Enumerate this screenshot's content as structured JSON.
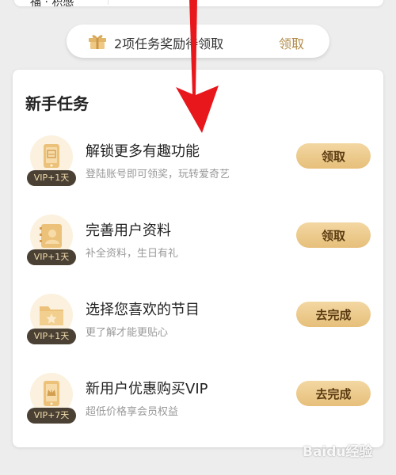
{
  "top_card": {
    "partial_text": "福 · 积感"
  },
  "reward_banner": {
    "text": "2项任务奖励待领取",
    "claim_label": "领取",
    "icon": "gift-icon"
  },
  "section": {
    "title": "新手任务"
  },
  "tasks": [
    {
      "icon": "tablet-icon",
      "badge": "VIP+1天",
      "title": "解锁更多有趣功能",
      "desc": "登陆账号即可领奖，玩转爱奇艺",
      "button": "领取"
    },
    {
      "icon": "profile-card-icon",
      "badge": "VIP+1天",
      "title": "完善用户资料",
      "desc": "补全资料，生日有礼",
      "button": "领取"
    },
    {
      "icon": "folder-star-icon",
      "badge": "VIP+1天",
      "title": "选择您喜欢的节目",
      "desc": "更了解才能更贴心",
      "button": "去完成"
    },
    {
      "icon": "phone-crown-icon",
      "badge": "VIP+7天",
      "title": "新用户优惠购买VIP",
      "desc": "超低价格享会员权益",
      "button": "去完成"
    }
  ],
  "watermark": "Baidu经验",
  "colors": {
    "accent_gold": "#e6bf7a",
    "badge_bg": "#4a4033",
    "arrow_red": "#e8171c",
    "claim_text": "#b08a47"
  }
}
